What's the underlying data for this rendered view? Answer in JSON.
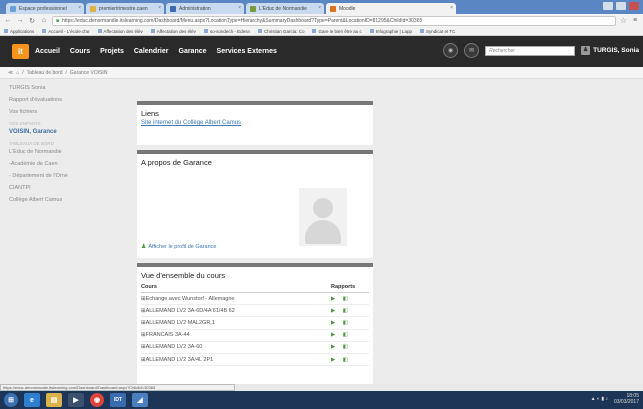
{
  "browser": {
    "tabs": [
      {
        "label": "Espace professionnel",
        "color": "#6aa0d8"
      },
      {
        "label": "premiertrimestre.caen",
        "color": "#e0b040"
      },
      {
        "label": "Administration",
        "color": "#3a6ab0"
      },
      {
        "label": "L'Educ de Normandie",
        "color": "#7a9a3a"
      },
      {
        "label": "Moodle",
        "color": "#e07020",
        "active": true
      }
    ],
    "url": "https://educ.denormandie.itslearning.com/Dashboard/Menu.aspx?LocationType=Hierarchy&SummaryDashboard?Type=Parent&LocationID=81295&ChildId=30365",
    "bookmarks": [
      "Applications",
      "Accueil - L'école d'ar",
      "Affectation des élèv",
      "Affectation des élèv",
      "so-sondech - Edesn",
      "Christian Garcia: Co",
      "Gare le bien être au c",
      "Infographie | Lapp",
      "Syndicat et TC"
    ]
  },
  "topnav": {
    "logo": "it",
    "links": [
      "Accueil",
      "Cours",
      "Projets",
      "Calendrier",
      "Garance",
      "Services Externes"
    ],
    "search_placeholder": "Rechercher",
    "user_name": "TURGIS, Sonia"
  },
  "breadcrumb": {
    "items": [
      "Tableau de bord",
      "Garance VOISIN"
    ]
  },
  "sidebar": {
    "top_items": [
      "TURGIS Sonia",
      "Rapport d'évaluations",
      "Vos fichiers"
    ],
    "children_head": "VOS ENFANTS",
    "child": "VOISIN, Garance",
    "dash_head": "TABLEAUX DE BORD",
    "dashboards": [
      "L'Educ de Normandie",
      "-Académie de Caen",
      "- Département de l'Orne",
      "CIANTPI",
      "Collège Albert Camus"
    ]
  },
  "main": {
    "links_panel": {
      "title": "Liens",
      "link": "Site internet du Collège Albert Camus"
    },
    "about_panel": {
      "title": "A propos de Garance",
      "profile_link": "Afficher le profil de Garance"
    },
    "courses_panel": {
      "title": "Vue d'ensemble du cours",
      "col_course": "Cours",
      "col_reports": "Rapports",
      "rows": [
        "Echange avec Wunstorf - Allemagne",
        "ALLEMAND LV2 3A-6D/4A 61/4B 62",
        "ALLEMAND LV2 MAL2GR.1",
        "FRANCAIS 3A-44",
        "ALLEMAND LV2 3A-60",
        "ALLEMAND LV2 3A/4L 2P1"
      ]
    }
  },
  "status_url": "https://educ.denormandie.itslearning.com/Dashboard/Dashboard.aspx?ChildId=30365",
  "taskbar": {
    "clock_time": "18:05",
    "clock_date": "03/03/2017"
  }
}
